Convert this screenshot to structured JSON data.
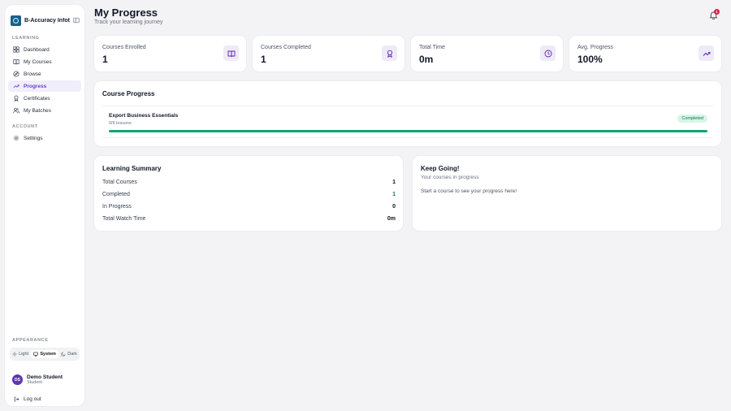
{
  "sidebar": {
    "brand": "B-Accuracy Infote...",
    "learning_label": "LEARNING",
    "items": [
      {
        "label": "Dashboard"
      },
      {
        "label": "My Courses"
      },
      {
        "label": "Browse"
      },
      {
        "label": "Progress"
      },
      {
        "label": "Certificates"
      },
      {
        "label": "My Batches"
      }
    ],
    "account_label": "ACCOUNT",
    "settings": "Settings",
    "appearance_label": "APPEARANCE",
    "appearance": {
      "light": "Light",
      "system": "System",
      "dark": "Dark"
    },
    "user": {
      "initials": "DS",
      "name": "Demo Student",
      "role": "Student"
    },
    "logout": "Log out"
  },
  "header": {
    "title": "My Progress",
    "subtitle": "Track your learning journey",
    "notifications": "1"
  },
  "stats": [
    {
      "label": "Courses Enrolled",
      "value": "1",
      "icon": "book-icon"
    },
    {
      "label": "Courses Completed",
      "value": "1",
      "icon": "award-icon"
    },
    {
      "label": "Total Time",
      "value": "0m",
      "icon": "clock-icon"
    },
    {
      "label": "Avg. Progress",
      "value": "100%",
      "icon": "trending-up-icon"
    }
  ],
  "course_progress": {
    "title": "Course Progress",
    "course": {
      "name": "Export Business Essentials",
      "lessons": "0/6 lessons",
      "status": "Completed",
      "progress": 1.0
    }
  },
  "summary": {
    "title": "Learning Summary",
    "rows": [
      {
        "label": "Total Courses",
        "value": "1"
      },
      {
        "label": "Completed",
        "value": "1"
      },
      {
        "label": "In Progress",
        "value": "0"
      },
      {
        "label": "Total Watch Time",
        "value": "0m"
      }
    ]
  },
  "keep_going": {
    "title": "Keep Going!",
    "subtitle": "Your courses in progress",
    "empty": "Start a course to see your progress here!"
  },
  "colors": {
    "accent": "#6b3fd1",
    "success": "#10a373",
    "badge_bg": "#d7f5e6"
  }
}
